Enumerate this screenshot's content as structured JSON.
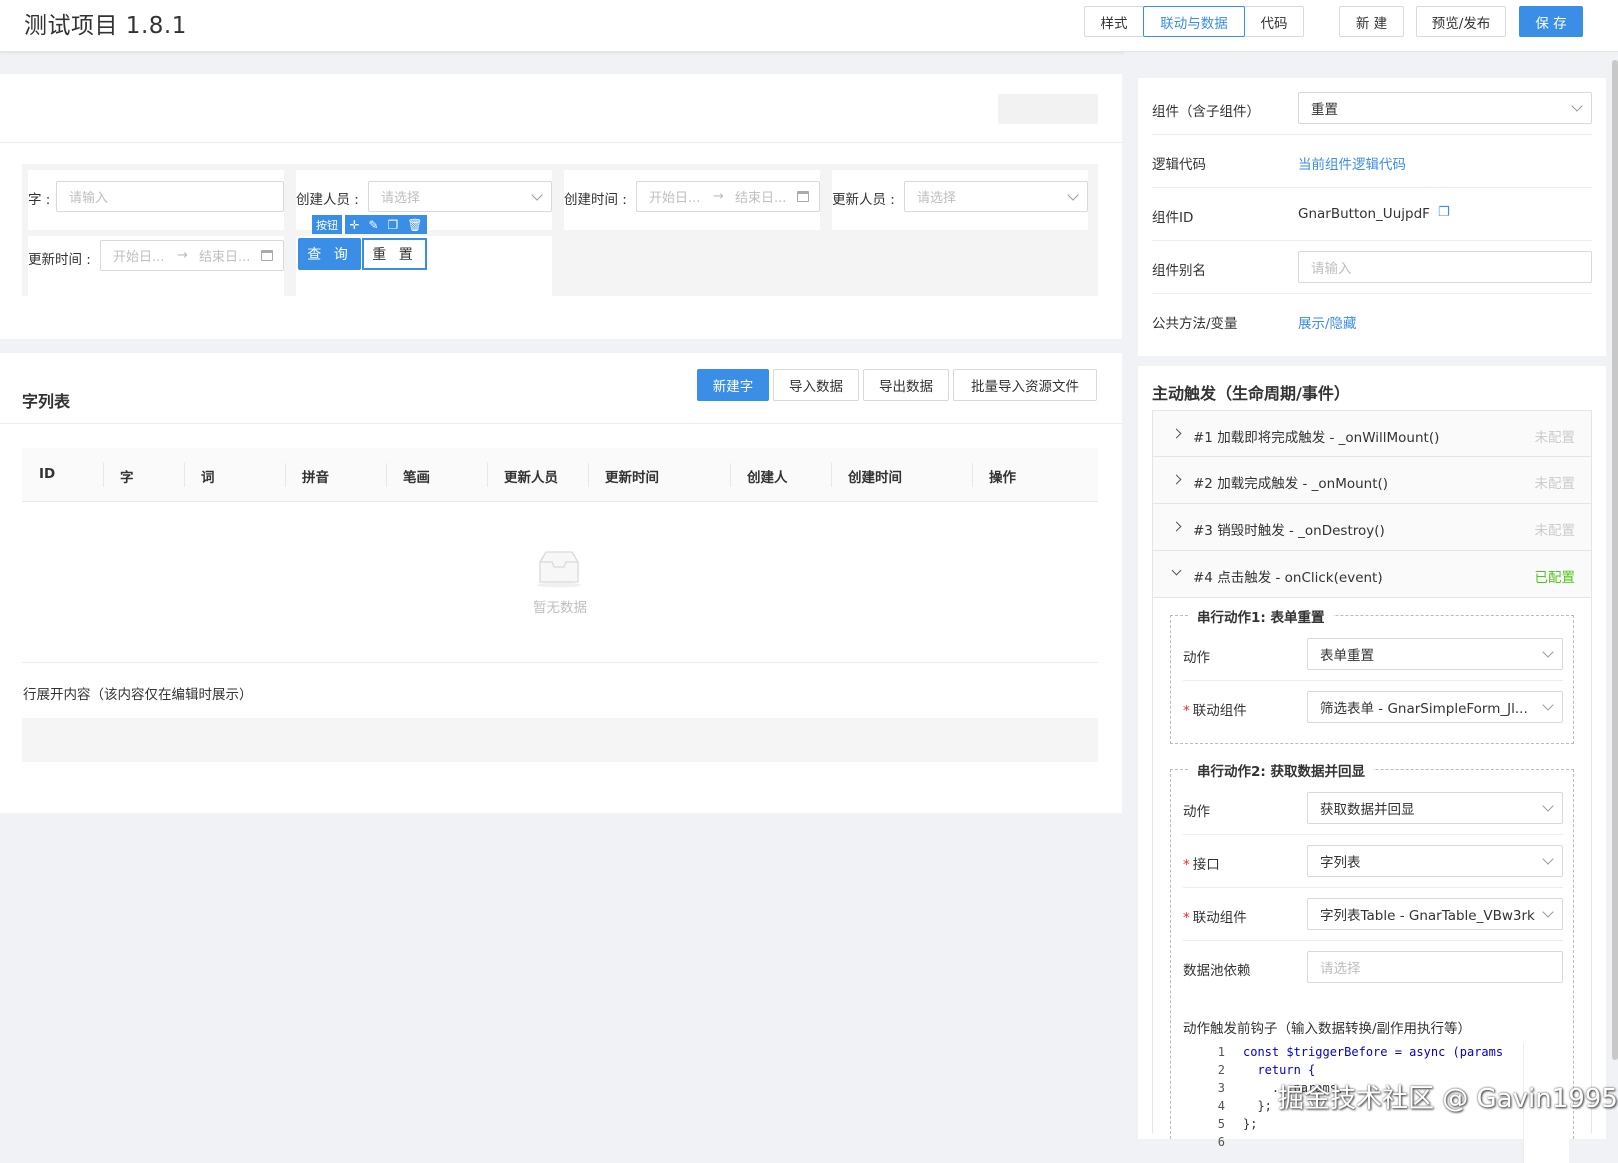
{
  "app": {
    "title": "测试项目 1.8.1"
  },
  "toolbar": {
    "tab_style": "样式",
    "tab_linkage": "联动与数据",
    "tab_code": "代码",
    "btn_new": "新 建",
    "btn_preview": "预览/发布",
    "btn_save": "保 存"
  },
  "form": {
    "field1_label": "字 :",
    "field1_placeholder": "请输入",
    "field2_label": "创建人员 :",
    "field2_placeholder": "请选择",
    "field3_label": "创建时间 :",
    "field3_start": "开始日...",
    "field3_end": "结束日...",
    "field4_label": "更新人员 :",
    "field4_placeholder": "请选择",
    "field5_label": "更新时间 :",
    "field5_start": "开始日...",
    "field5_end": "结束日...",
    "selected_tag": "按钮",
    "btn_query": "查 询",
    "btn_reset": "重 置"
  },
  "table": {
    "title": "字列表",
    "actions": [
      "新建字",
      "导入数据",
      "导出数据",
      "批量导入资源文件"
    ],
    "columns": [
      "ID",
      "字",
      "词",
      "拼音",
      "笔画",
      "更新人员",
      "更新时间",
      "创建人",
      "创建时间",
      "操作"
    ],
    "empty_text": "暂无数据",
    "expand_text": "行展开内容（该内容仅在编辑时展示）"
  },
  "props": {
    "component_label": "组件（含子组件）",
    "component_value": "重置",
    "logic_label": "逻辑代码",
    "logic_link": "当前组件逻辑代码",
    "id_label": "组件ID",
    "id_value": "GnarButton_UujpdF",
    "alias_label": "组件别名",
    "alias_placeholder": "请输入",
    "public_label": "公共方法/变量",
    "public_link": "展示/隐藏"
  },
  "triggers": {
    "title": "主动触发（生命周期/事件）",
    "items": [
      {
        "text": "#1 加载即将完成触发 - _onWillMount()",
        "status": "未配置"
      },
      {
        "text": "#2 加载完成触发 - _onMount()",
        "status": "未配置"
      },
      {
        "text": "#3 销毁时触发 - _onDestroy()",
        "status": "未配置"
      },
      {
        "text": "#4 点击触发 - onClick(event)",
        "status": "已配置"
      }
    ],
    "action1": {
      "title": "串行动作1: 表单重置",
      "action_label": "动作",
      "action_value": "表单重置",
      "link_label": "联动组件",
      "link_value": "筛选表单 - GnarSimpleForm_Jl..."
    },
    "action2": {
      "title": "串行动作2: 获取数据并回显",
      "action_label": "动作",
      "action_value": "获取数据并回显",
      "api_label": "接口",
      "api_value": "字列表",
      "link_label": "联动组件",
      "link_value": "字列表Table - GnarTable_VBw3rk",
      "pool_label": "数据池依赖",
      "pool_placeholder": "请选择",
      "hook_label": "动作触发前钩子（输入数据转换/副作用执行等）"
    },
    "code_lines": [
      {
        "n": "1",
        "t": "const $triggerBefore = async (params"
      },
      {
        "n": "2",
        "t": "  return {"
      },
      {
        "n": "3",
        "t": "    ...params,"
      },
      {
        "n": "4",
        "t": "  };"
      },
      {
        "n": "5",
        "t": "};"
      },
      {
        "n": "6",
        "t": ""
      }
    ]
  },
  "watermark": "掘金技术社区 @ Gavin1995",
  "colors": {
    "accent": "#3a8ee6",
    "ok": "#52c41a",
    "required": "#f5222d"
  }
}
